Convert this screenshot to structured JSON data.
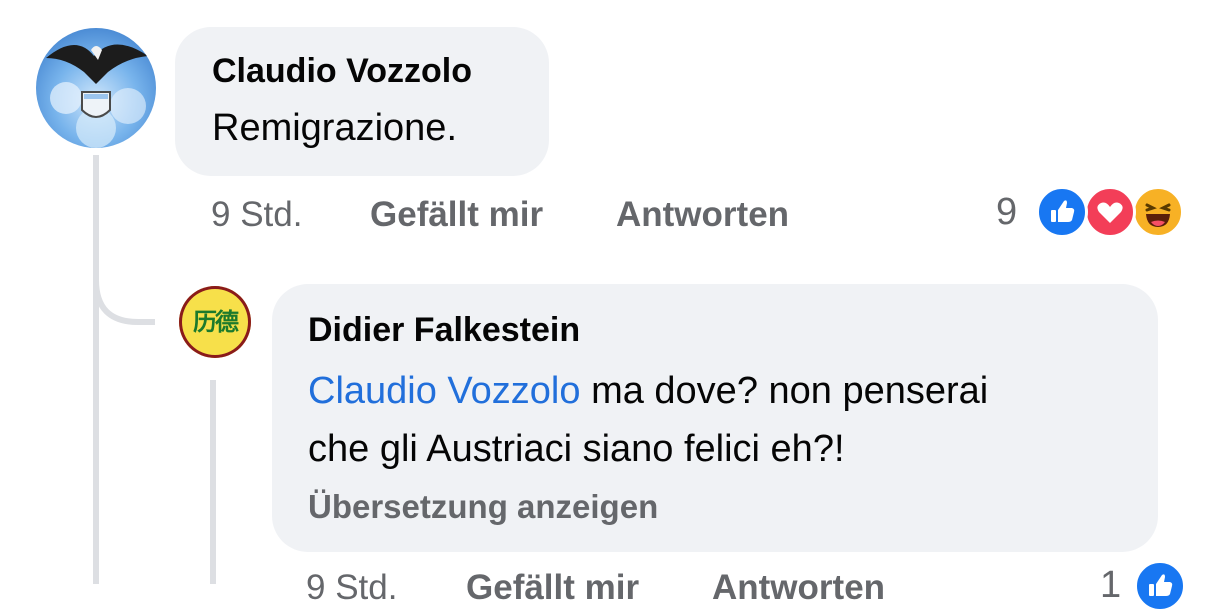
{
  "comment": {
    "author": "Claudio Vozzolo",
    "text": "Remigrazione.",
    "time": "9 Std.",
    "like_label": "Gefällt mir",
    "reply_label": "Antworten",
    "reaction_count": "9",
    "reactions": [
      "like-icon",
      "love-icon",
      "haha-icon"
    ]
  },
  "reply": {
    "author": "Didier Falkestein",
    "mention": "Claudio Vozzolo",
    "text_line1": " ma dove? non penserai",
    "text_line2": "che gli Austriaci siano felici eh?!",
    "translate_label": "Übersetzung anzeigen",
    "avatar_text": "历德",
    "time": "9 Std.",
    "like_label": "Gefällt mir",
    "reply_label": "Antworten",
    "reaction_count": "1",
    "reactions": [
      "like-icon"
    ]
  },
  "colors": {
    "bubble": "#f0f2f5",
    "mention": "#216fdb",
    "meta": "#65676b",
    "like": "#1877f2",
    "love": "#f33e58",
    "haha": "#f7b125"
  }
}
